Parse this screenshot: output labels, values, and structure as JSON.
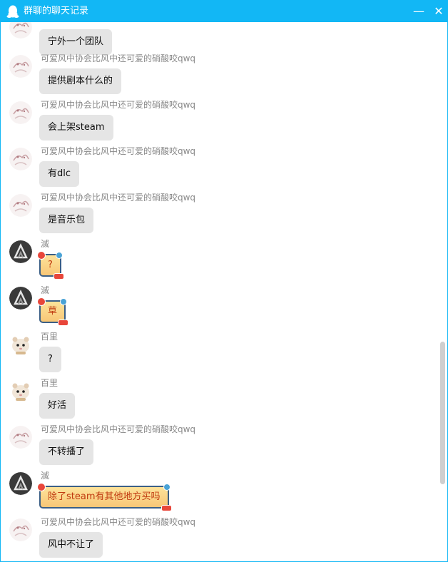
{
  "window": {
    "title": "群聊的聊天记录",
    "minimize": "—",
    "close": "✕",
    "accent": "#12b7f5"
  },
  "messages": [
    {
      "sender": "",
      "text": "宁外一个团队",
      "avatar": "anime",
      "fancy": false
    },
    {
      "sender": "可爱风中协会比风中还可爱的硝酸咬qwq",
      "text": "提供剧本什么的",
      "avatar": "anime",
      "fancy": false
    },
    {
      "sender": "可爱风中协会比风中还可爱的硝酸咬qwq",
      "text": "会上架steam",
      "avatar": "anime",
      "fancy": false
    },
    {
      "sender": "可爱风中协会比风中还可爱的硝酸咬qwq",
      "text": "有dlc",
      "avatar": "anime",
      "fancy": false
    },
    {
      "sender": "可爱风中协会比风中还可爱的硝酸咬qwq",
      "text": "是音乐包",
      "avatar": "anime",
      "fancy": false
    },
    {
      "sender": "滅",
      "text": "?",
      "avatar": "logo",
      "fancy": true
    },
    {
      "sender": "滅",
      "text": "草",
      "avatar": "logo",
      "fancy": true
    },
    {
      "sender": "百里",
      "text": "?",
      "avatar": "hamster",
      "fancy": false
    },
    {
      "sender": "百里",
      "text": "好活",
      "avatar": "hamster",
      "fancy": false
    },
    {
      "sender": "可爱风中协会比风中还可爱的硝酸咬qwq",
      "text": "不转播了",
      "avatar": "anime",
      "fancy": false
    },
    {
      "sender": "滅",
      "text": "除了steam有其他地方买吗",
      "avatar": "logo",
      "fancy": true
    },
    {
      "sender": "可爱风中协会比风中还可爱的硝酸咬qwq",
      "text": "风中不让了",
      "avatar": "anime",
      "fancy": false
    }
  ]
}
